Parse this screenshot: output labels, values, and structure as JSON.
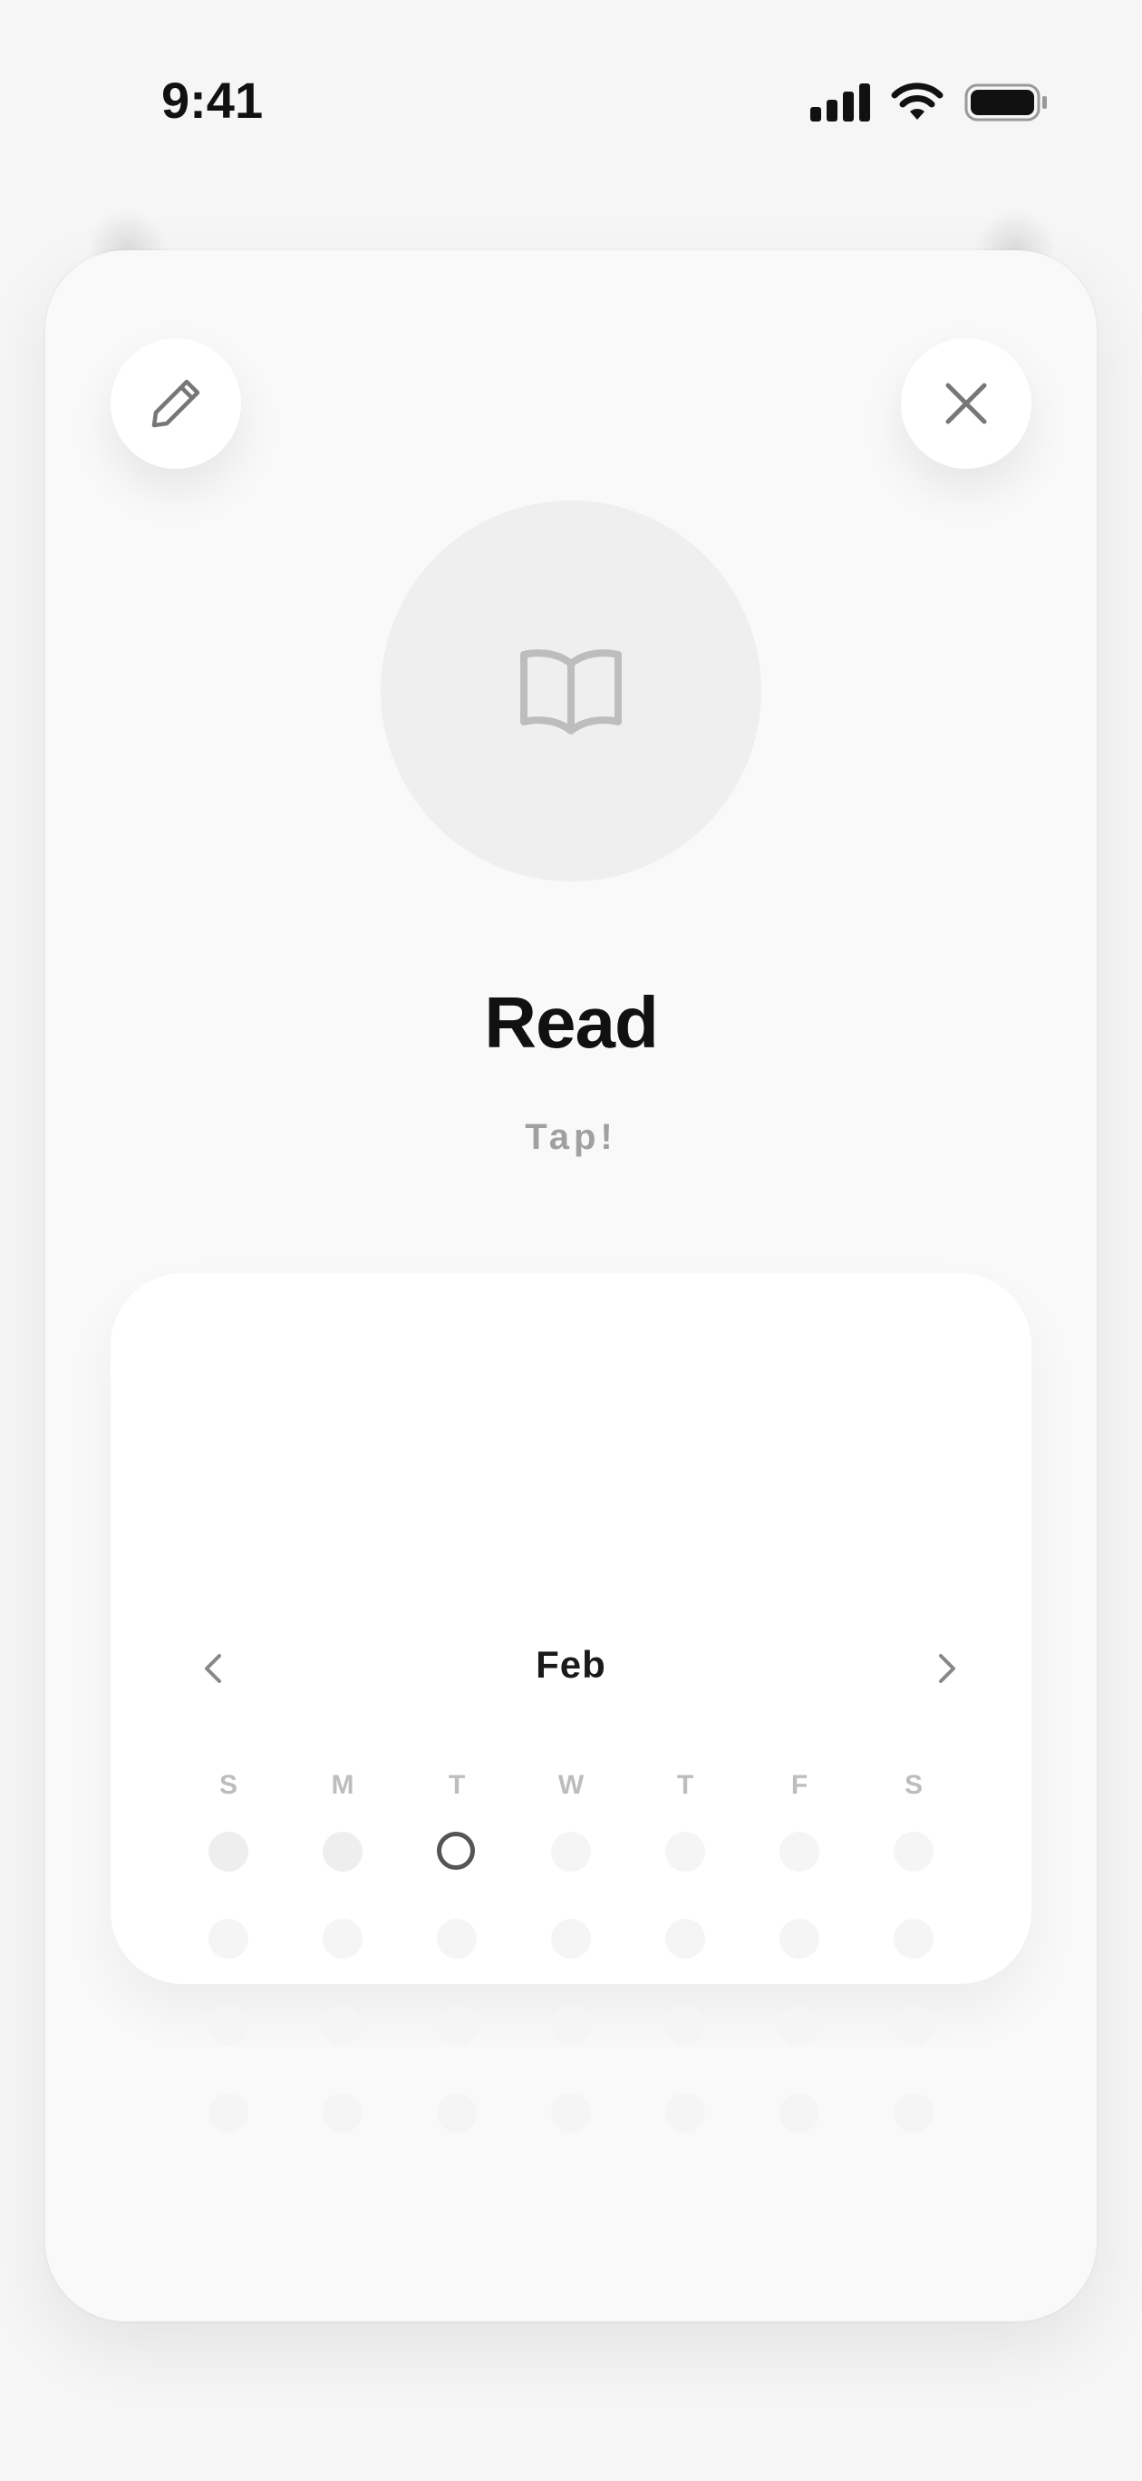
{
  "status_bar": {
    "time": "9:41",
    "signal_icon": "cellular-signal-icon",
    "wifi_icon": "wifi-icon",
    "battery_icon": "battery-icon"
  },
  "card": {
    "edit_icon": "pencil-icon",
    "close_icon": "close-icon",
    "habit_icon": "open-book-icon",
    "title": "Read",
    "subtitle": "Tap!"
  },
  "calendar": {
    "month": "Feb",
    "prev_icon": "chevron-left-icon",
    "next_icon": "chevron-right-icon",
    "weekdays": [
      "S",
      "M",
      "T",
      "W",
      "T",
      "F",
      "S"
    ],
    "weeks": [
      [
        "past",
        "past",
        "today",
        "future",
        "future",
        "future",
        "future"
      ],
      [
        "future",
        "future",
        "future",
        "future",
        "future",
        "future",
        "future"
      ],
      [
        "future",
        "future",
        "future",
        "future",
        "future",
        "future",
        "future"
      ],
      [
        "future",
        "future",
        "future",
        "future",
        "future",
        "future",
        "future"
      ]
    ]
  },
  "colors": {
    "background": "#f6f6f6",
    "card": "#f9f9f9",
    "today_ring": "#555555",
    "text_primary": "#111111",
    "text_muted": "#a0a0a0"
  }
}
